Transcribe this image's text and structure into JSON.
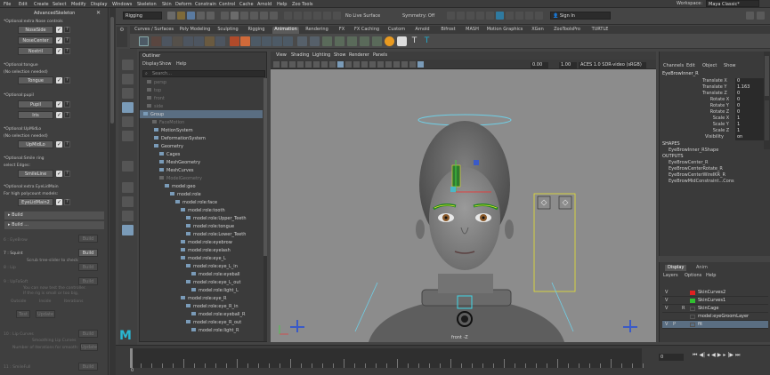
{
  "menubar": [
    "File",
    "Edit",
    "Create",
    "Select",
    "Modify",
    "Display",
    "Windows",
    "Skeleton",
    "Skin",
    "Deform",
    "Constrain",
    "Control",
    "Cache",
    "Arnold",
    "Help",
    "Zoo Tools"
  ],
  "workspace": {
    "label": "Workspace:",
    "value": "Maya Classic*"
  },
  "status": {
    "mode": "Rigging",
    "live_surface": "No Live Surface",
    "symmetry": "Symmetry: Off",
    "sign_in": "Sign In"
  },
  "shelf_tabs": [
    "Curves / Surfaces",
    "Poly Modeling",
    "Sculpting",
    "Rigging",
    "Animation",
    "Rendering",
    "FX",
    "FX Caching",
    "Custom",
    "Arnold",
    "Bifrost",
    "MASH",
    "Motion Graphics",
    "XGen",
    "ZooToolsPro",
    "TURTLE"
  ],
  "shelf_active": "Animation",
  "left_panel": {
    "title": "AdvancedSkeleton",
    "s1_header": "*Optional:extra Nose controls",
    "nose_side": "NoseSide",
    "nose_center": "NoseCenter",
    "nostril": "Nostril",
    "s2_header": "*Optional:tongue",
    "s2_note": "(No selection needed)",
    "tongue": "Tongue",
    "s3_header": "*Optional:pupil",
    "pupil": "Pupil",
    "iris": "Iris",
    "s4_header": "*Optional:UpMidLo",
    "s4_note": "(No selection needed)",
    "upmidlo": "UpMidLo",
    "s5_header": "*Optional:Smile ring",
    "s5_note": "select Edges:",
    "smile_line": "SmileLine",
    "s6_header": "*Optional:extra EyeLidMain",
    "s6_note": "For high polycount models:",
    "eyelid_main": "EyeLidMain2",
    "build": "Build",
    "build2": "Build ...",
    "eyebrow_label": "6 : EyeBrow",
    "squint_label": "7 : Squint",
    "squint_note": "Scrub tree-slider to check",
    "lip_label": "8 : Lip",
    "uplidlo_label": "9 : UpFaSoft",
    "uplid_note1": "You can now test the controller.",
    "uplid_note2": "If the rig is small or too big,",
    "outside": "Outside",
    "inside": "Inside",
    "iterations": "Iterations",
    "test": "Test",
    "update": "Update",
    "lipcurve_label": "10 : Lip Curves",
    "lipcurve_note": "Smoothing Lip Curves",
    "lipcurve_sub": "Number of Iterations for smooth:",
    "smileful_label": "11 : SmileFull"
  },
  "outliner": {
    "title": "Outliner",
    "menu": [
      "Display",
      "Show",
      "Help"
    ],
    "search": "Search...",
    "items": [
      {
        "label": "persp",
        "dim": true
      },
      {
        "label": "top",
        "dim": true
      },
      {
        "label": "front",
        "dim": true
      },
      {
        "label": "side",
        "dim": true
      },
      {
        "label": "Group",
        "dim": false,
        "selected": true
      },
      {
        "label": "FaceMotion",
        "dim": true
      },
      {
        "label": "MotionSystem",
        "dim": false
      },
      {
        "label": "DeformationSystem",
        "dim": false
      },
      {
        "label": "Geometry",
        "dim": false
      },
      {
        "label": "Cages",
        "dim": false
      },
      {
        "label": "MeshGeometry",
        "dim": false
      },
      {
        "label": "MeshCurves",
        "dim": false
      },
      {
        "label": "ModelGeometry",
        "dim": true
      },
      {
        "label": "model:geo",
        "dim": false
      },
      {
        "label": "model:role",
        "dim": false
      },
      {
        "label": "model:role:face",
        "dim": false
      },
      {
        "label": "model:role:tooth",
        "dim": false
      },
      {
        "label": "model:role:Upper_Teeth",
        "dim": false
      },
      {
        "label": "model:role:tongue",
        "dim": false
      },
      {
        "label": "model:role:Lower_Teeth",
        "dim": false
      },
      {
        "label": "model:role:eyebrow",
        "dim": false
      },
      {
        "label": "model:role:eyelash",
        "dim": false
      },
      {
        "label": "model:role:eye_L",
        "dim": false
      },
      {
        "label": "model:role:eye_L_in",
        "dim": false
      },
      {
        "label": "model:role:eyeball",
        "dim": false
      },
      {
        "label": "model:role:eye_L_out",
        "dim": false
      },
      {
        "label": "model:role:light_L",
        "dim": false
      },
      {
        "label": "model:role:eye_R",
        "dim": false
      },
      {
        "label": "model:role:eye_R_in",
        "dim": false
      },
      {
        "label": "model:role:eyeball_R",
        "dim": false
      },
      {
        "label": "model:role:eye_R_out",
        "dim": false
      },
      {
        "label": "model:role:light_R",
        "dim": false
      }
    ]
  },
  "viewport": {
    "menu": [
      "View",
      "Shading",
      "Lighting",
      "Show",
      "Renderer",
      "Panels"
    ],
    "val1": "0.00",
    "val2": "1.00",
    "colorspace": "ACES 1.0 SDR-video (sRGB)",
    "camera_label": "front -Z"
  },
  "channel_box": {
    "menu": [
      "Channels",
      "Edit",
      "Object",
      "Show"
    ],
    "object": "EyeBrowInner_R",
    "channels": [
      {
        "name": "Translate X",
        "value": "0"
      },
      {
        "name": "Translate Y",
        "value": "1.163"
      },
      {
        "name": "Translate Z",
        "value": "0"
      },
      {
        "name": "Rotate X",
        "value": "0"
      },
      {
        "name": "Rotate Y",
        "value": "0"
      },
      {
        "name": "Rotate Z",
        "value": "0"
      },
      {
        "name": "Scale X",
        "value": "1"
      },
      {
        "name": "Scale Y",
        "value": "1"
      },
      {
        "name": "Scale Z",
        "value": "1"
      },
      {
        "name": "Visibility",
        "value": "on"
      }
    ],
    "shapes_header": "SHAPES",
    "shape": "EyeBrowInner_RShape",
    "outputs_header": "OUTPUTS",
    "outputs": [
      "EyeBrowCenter_R",
      "EyeBrowCenterRotate_R",
      "EyeBrowCenterWireIKR_R",
      "EyeBrowMidConstraint...Cons"
    ]
  },
  "layers": {
    "tabs": [
      "Display",
      "Anim"
    ],
    "menu": [
      "Layers",
      "Options",
      "Help"
    ],
    "rows": [
      {
        "v": "V",
        "p": "",
        "r": "",
        "color": "#e02020",
        "name": "SkinCurves2"
      },
      {
        "v": "V",
        "p": "",
        "r": "",
        "color": "#30c030",
        "name": "SkinCurves1"
      },
      {
        "v": "V",
        "p": "",
        "r": "R",
        "color": "",
        "name": "SkinCage"
      },
      {
        "v": "",
        "p": "",
        "r": "",
        "color": "",
        "name": "model:eyeGroomLayer"
      },
      {
        "v": "V",
        "p": "P",
        "r": "",
        "color": "",
        "name": "fit",
        "selected": true
      }
    ]
  },
  "timeline": {
    "start": "0",
    "current": "0"
  }
}
